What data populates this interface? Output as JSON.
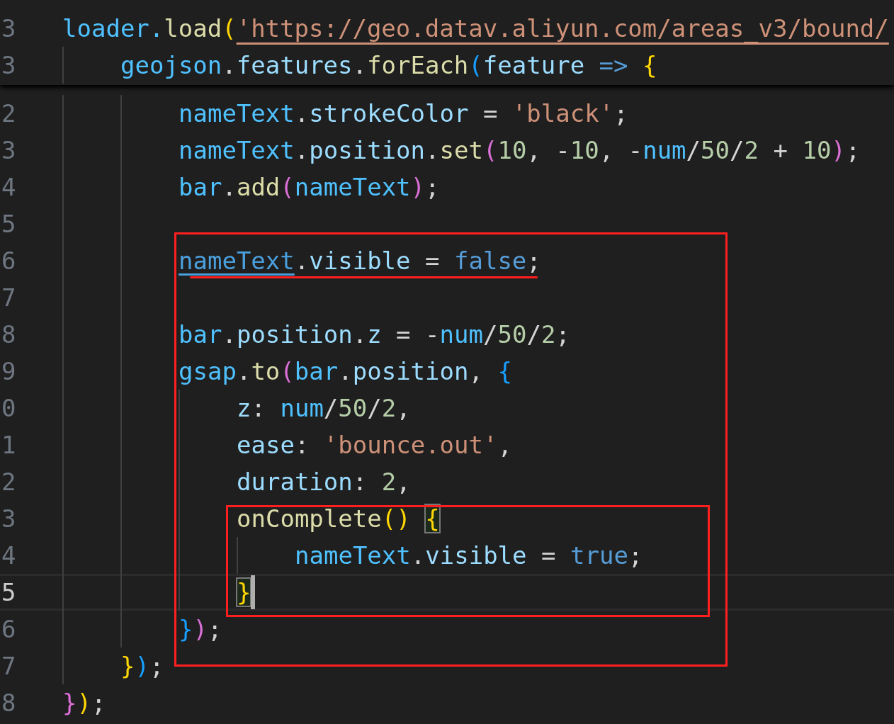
{
  "sticky_lines": [
    {
      "number": "3",
      "tokens": [
        {
          "kind": "variable",
          "text": "loader."
        },
        {
          "kind": "method",
          "text": "load"
        },
        {
          "kind": "paren1",
          "text": "("
        },
        {
          "kind": "link",
          "text": "'https://geo.datav.aliyun.com/areas_v3/bound/"
        }
      ]
    },
    {
      "number": "3",
      "tokens": [
        {
          "kind": "variable",
          "text": "    geojson"
        },
        {
          "kind": "punct",
          "text": "."
        },
        {
          "kind": "property",
          "text": "features"
        },
        {
          "kind": "punct",
          "text": "."
        },
        {
          "kind": "method",
          "text": "forEach"
        },
        {
          "kind": "paren3",
          "text": "("
        },
        {
          "kind": "property",
          "text": "feature"
        },
        {
          "kind": "keyword",
          "text": " => "
        },
        {
          "kind": "paren1",
          "text": "{"
        }
      ]
    }
  ],
  "lines": [
    {
      "number": "2",
      "current": false,
      "tokens": [
        {
          "kind": "variable",
          "text": "        nameText"
        },
        {
          "kind": "punct",
          "text": "."
        },
        {
          "kind": "property",
          "text": "strokeColor"
        },
        {
          "kind": "punct",
          "text": " = "
        },
        {
          "kind": "string",
          "text": "'black'"
        },
        {
          "kind": "punct",
          "text": ";"
        }
      ]
    },
    {
      "number": "3",
      "current": false,
      "tokens": [
        {
          "kind": "variable",
          "text": "        nameText"
        },
        {
          "kind": "punct",
          "text": "."
        },
        {
          "kind": "property",
          "text": "position"
        },
        {
          "kind": "punct",
          "text": "."
        },
        {
          "kind": "method",
          "text": "set"
        },
        {
          "kind": "paren2",
          "text": "("
        },
        {
          "kind": "number",
          "text": "10"
        },
        {
          "kind": "punct",
          "text": ", -"
        },
        {
          "kind": "number",
          "text": "10"
        },
        {
          "kind": "punct",
          "text": ", -"
        },
        {
          "kind": "variable",
          "text": "num"
        },
        {
          "kind": "punct",
          "text": "/"
        },
        {
          "kind": "number",
          "text": "50"
        },
        {
          "kind": "punct",
          "text": "/"
        },
        {
          "kind": "number",
          "text": "2"
        },
        {
          "kind": "punct",
          "text": " + "
        },
        {
          "kind": "number",
          "text": "10"
        },
        {
          "kind": "paren2",
          "text": ")"
        },
        {
          "kind": "punct",
          "text": ";"
        }
      ]
    },
    {
      "number": "4",
      "current": false,
      "tokens": [
        {
          "kind": "variable",
          "text": "        bar"
        },
        {
          "kind": "punct",
          "text": "."
        },
        {
          "kind": "method",
          "text": "add"
        },
        {
          "kind": "paren2",
          "text": "("
        },
        {
          "kind": "variable",
          "text": "nameText"
        },
        {
          "kind": "paren2",
          "text": ")"
        },
        {
          "kind": "punct",
          "text": ";"
        }
      ]
    },
    {
      "number": "5",
      "current": false
    },
    {
      "number": "6",
      "current": false,
      "tokens": [
        {
          "kind": "hovered",
          "text": "        nameText"
        },
        {
          "kind": "punct",
          "text": "."
        },
        {
          "kind": "property",
          "text": "visible"
        },
        {
          "kind": "punct",
          "text": " = "
        },
        {
          "kind": "keyword",
          "text": "false"
        },
        {
          "kind": "punct",
          "text": ";"
        }
      ]
    },
    {
      "number": "7",
      "current": false
    },
    {
      "number": "8",
      "current": false,
      "tokens": [
        {
          "kind": "variable",
          "text": "        bar"
        },
        {
          "kind": "punct",
          "text": "."
        },
        {
          "kind": "property",
          "text": "position"
        },
        {
          "kind": "punct",
          "text": "."
        },
        {
          "kind": "property",
          "text": "z"
        },
        {
          "kind": "punct",
          "text": " = -"
        },
        {
          "kind": "variable",
          "text": "num"
        },
        {
          "kind": "punct",
          "text": "/"
        },
        {
          "kind": "number",
          "text": "50"
        },
        {
          "kind": "punct",
          "text": "/"
        },
        {
          "kind": "number",
          "text": "2"
        },
        {
          "kind": "punct",
          "text": ";"
        }
      ]
    },
    {
      "number": "9",
      "current": false,
      "tokens": [
        {
          "kind": "variable",
          "text": "        gsap"
        },
        {
          "kind": "punct",
          "text": "."
        },
        {
          "kind": "method",
          "text": "to"
        },
        {
          "kind": "paren2",
          "text": "("
        },
        {
          "kind": "variable",
          "text": "bar"
        },
        {
          "kind": "punct",
          "text": "."
        },
        {
          "kind": "property",
          "text": "position"
        },
        {
          "kind": "punct",
          "text": ", "
        },
        {
          "kind": "paren3",
          "text": "{"
        }
      ]
    },
    {
      "number": "0",
      "current": false,
      "tokens": [
        {
          "kind": "property",
          "text": "            z"
        },
        {
          "kind": "punct",
          "text": ": "
        },
        {
          "kind": "variable",
          "text": "num"
        },
        {
          "kind": "punct",
          "text": "/"
        },
        {
          "kind": "number",
          "text": "50"
        },
        {
          "kind": "punct",
          "text": "/"
        },
        {
          "kind": "number",
          "text": "2"
        },
        {
          "kind": "punct",
          "text": ","
        }
      ]
    },
    {
      "number": "1",
      "current": false,
      "tokens": [
        {
          "kind": "property",
          "text": "            ease"
        },
        {
          "kind": "punct",
          "text": ": "
        },
        {
          "kind": "string",
          "text": "'bounce.out'"
        },
        {
          "kind": "punct",
          "text": ","
        }
      ]
    },
    {
      "number": "2",
      "current": false,
      "tokens": [
        {
          "kind": "property",
          "text": "            duration"
        },
        {
          "kind": "punct",
          "text": ": "
        },
        {
          "kind": "number",
          "text": "2"
        },
        {
          "kind": "punct",
          "text": ","
        }
      ]
    },
    {
      "number": "3",
      "current": false,
      "tokens": [
        {
          "kind": "method",
          "text": "            onComplete"
        },
        {
          "kind": "paren1",
          "text": "() "
        },
        {
          "kind": "paren1",
          "text": "{",
          "matched": true
        }
      ]
    },
    {
      "number": "4",
      "current": false,
      "tokens": [
        {
          "kind": "variable",
          "text": "                nameText"
        },
        {
          "kind": "punct",
          "text": "."
        },
        {
          "kind": "property",
          "text": "visible"
        },
        {
          "kind": "punct",
          "text": " = "
        },
        {
          "kind": "keyword",
          "text": "true"
        },
        {
          "kind": "punct",
          "text": ";"
        }
      ]
    },
    {
      "number": "5",
      "current": true,
      "tokens": [
        {
          "kind": "paren1",
          "text": "            }",
          "matched": true
        }
      ]
    },
    {
      "number": "6",
      "current": false,
      "tokens": [
        {
          "kind": "paren3",
          "text": "        }"
        },
        {
          "kind": "paren2",
          "text": ")"
        },
        {
          "kind": "punct",
          "text": ";"
        }
      ]
    },
    {
      "number": "7",
      "current": false,
      "tokens": [
        {
          "kind": "paren1",
          "text": "    }"
        },
        {
          "kind": "paren3",
          "text": ")"
        },
        {
          "kind": "punct",
          "text": ";"
        }
      ]
    },
    {
      "number": "8",
      "current": false,
      "tokens": [
        {
          "kind": "paren2",
          "text": "}"
        },
        {
          "kind": "paren1",
          "text": ")"
        },
        {
          "kind": "punct",
          "text": ";"
        }
      ]
    }
  ]
}
